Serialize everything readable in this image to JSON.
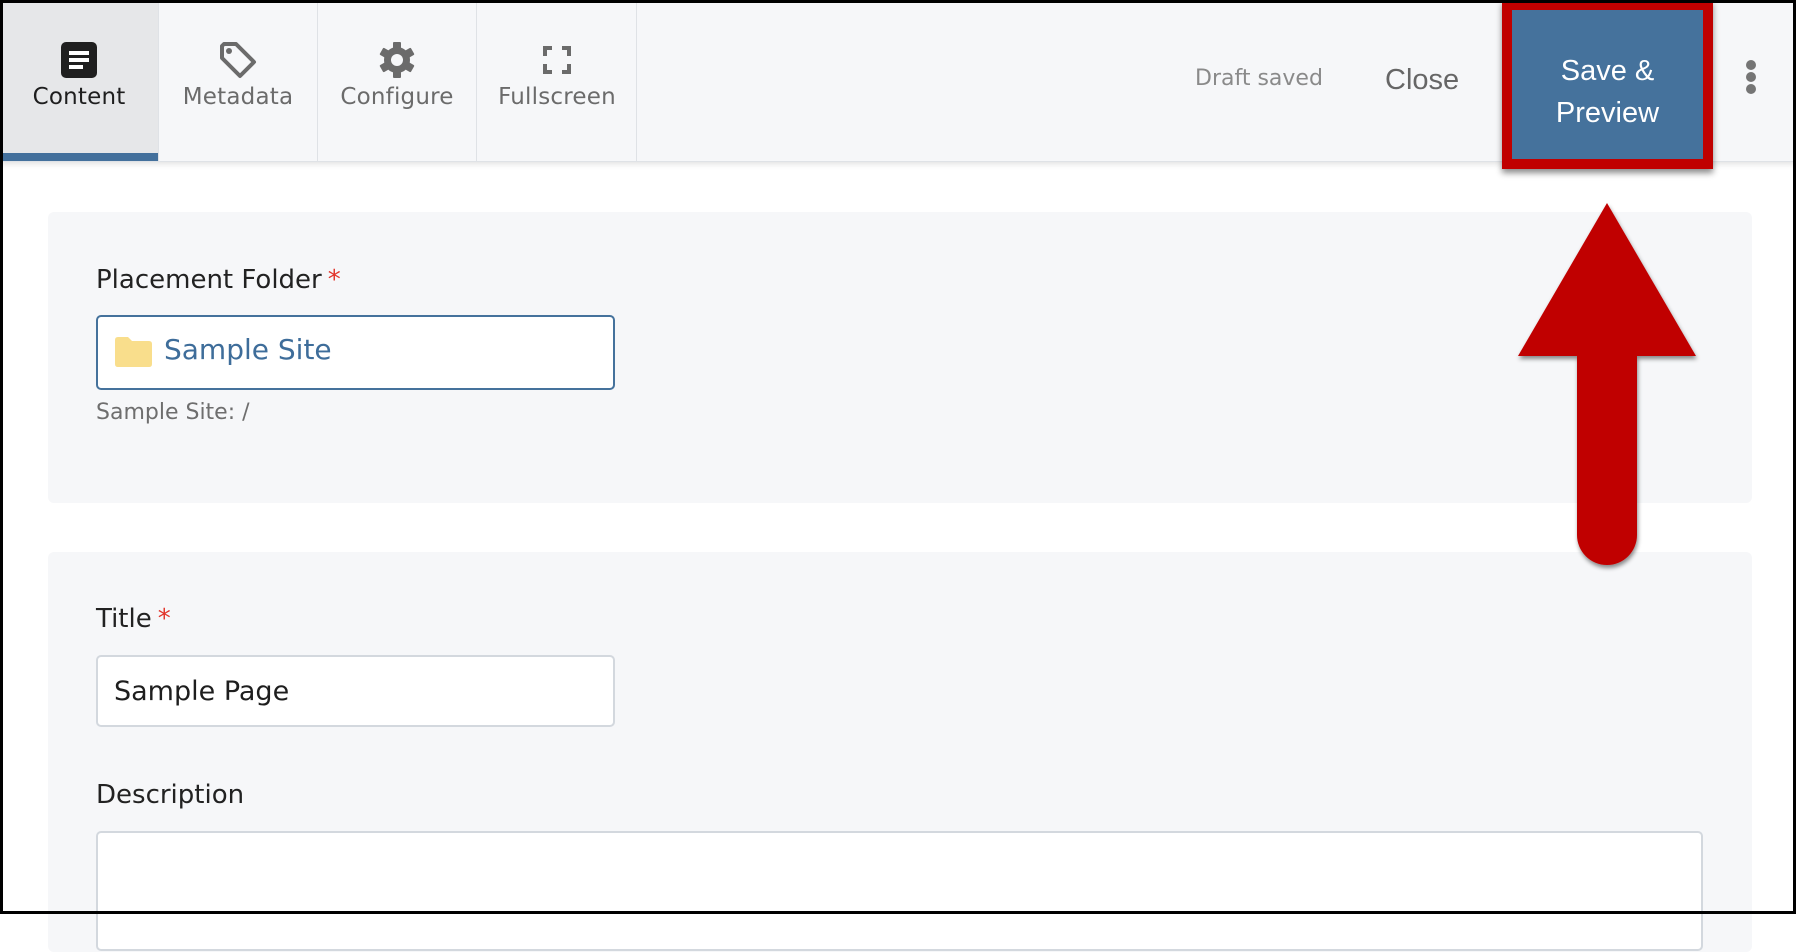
{
  "header": {
    "tabs": [
      {
        "label": "Content",
        "icon": "document-icon",
        "active": true
      },
      {
        "label": "Metadata",
        "icon": "tag-icon",
        "active": false
      },
      {
        "label": "Configure",
        "icon": "gear-icon",
        "active": false
      },
      {
        "label": "Fullscreen",
        "icon": "fullscreen-icon",
        "active": false
      }
    ],
    "status_text": "Draft saved",
    "close_label": "Close",
    "save_preview_label_line1": "Save &",
    "save_preview_label_line2": "Preview",
    "more_menu_icon": "kebab-menu-icon"
  },
  "form": {
    "placement_folder": {
      "label": "Placement Folder",
      "required_marker": "*",
      "value": "Sample Site",
      "icon": "folder-icon",
      "helper_text": "Sample Site: /"
    },
    "title": {
      "label": "Title",
      "required_marker": "*",
      "value": "Sample Page"
    },
    "description": {
      "label": "Description",
      "value": ""
    }
  },
  "annotation": {
    "highlight": "save-preview-button",
    "arrow_direction": "up",
    "color": "#c00000"
  },
  "colors": {
    "accent": "#45729c",
    "required": "#e2352b",
    "folder": "#f9de8c",
    "annotation": "#c00000"
  }
}
